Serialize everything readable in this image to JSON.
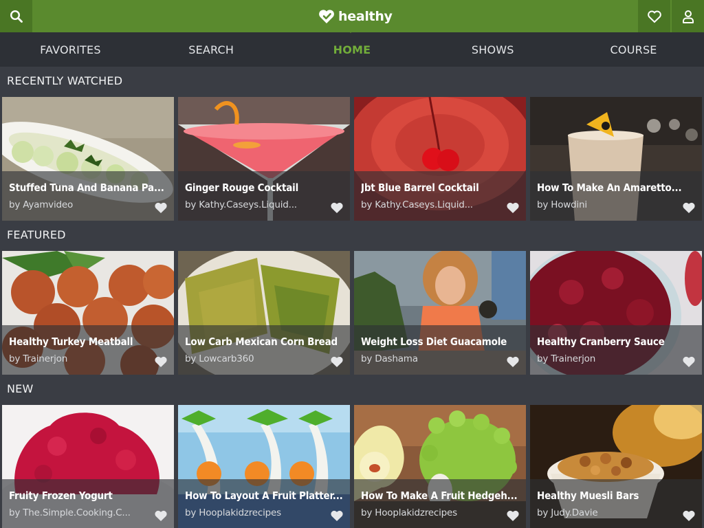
{
  "app": {
    "logo_text": "healthy"
  },
  "header": {
    "search_icon": "search-icon",
    "favorites_icon": "heart-icon",
    "profile_icon": "user-icon"
  },
  "nav": {
    "items": [
      {
        "label": "FAVORITES",
        "active": false
      },
      {
        "label": "SEARCH",
        "active": false
      },
      {
        "label": "HOME",
        "active": true
      },
      {
        "label": "SHOWS",
        "active": false
      },
      {
        "label": "COURSE",
        "active": false
      }
    ],
    "active_color": "#72ad3a"
  },
  "sections": [
    {
      "title": "RECENTLY WATCHED",
      "videos": [
        {
          "title": "Stuffed Tuna And Banana Pa...",
          "author": "by Ayamvideo"
        },
        {
          "title": "Ginger Rouge Cocktail",
          "author": "by Kathy.Caseys.Liquid..."
        },
        {
          "title": "Jbt Blue Barrel Cocktail",
          "author": "by Kathy.Caseys.Liquid..."
        },
        {
          "title": "How To Make An Amaretto...",
          "author": "by Howdini"
        }
      ]
    },
    {
      "title": "FEATURED",
      "videos": [
        {
          "title": "Healthy Turkey Meatball",
          "author": "by Trainerjon"
        },
        {
          "title": "Low Carb Mexican Corn Bread",
          "author": "by Lowcarb360"
        },
        {
          "title": "Weight Loss Diet Guacamole",
          "author": "by Dashama"
        },
        {
          "title": "Healthy Cranberry Sauce",
          "author": "by Trainerjon"
        }
      ]
    },
    {
      "title": "NEW",
      "videos": [
        {
          "title": "Fruity Frozen Yogurt",
          "author": "by The.Simple.Cooking.C..."
        },
        {
          "title": "How To Layout A Fruit Platter...",
          "author": "by Hooplakidzrecipes"
        },
        {
          "title": "How To Make A Fruit Hedgeh...",
          "author": "by Hooplakidzrecipes"
        },
        {
          "title": "Healthy Muesli Bars",
          "author": "by Judy.Davie"
        }
      ]
    }
  ],
  "colors": {
    "brand_green": "#5a8a2e",
    "brand_green_dark": "#4a7624",
    "nav_bg": "#2d3036",
    "page_bg": "#3a3d44"
  }
}
